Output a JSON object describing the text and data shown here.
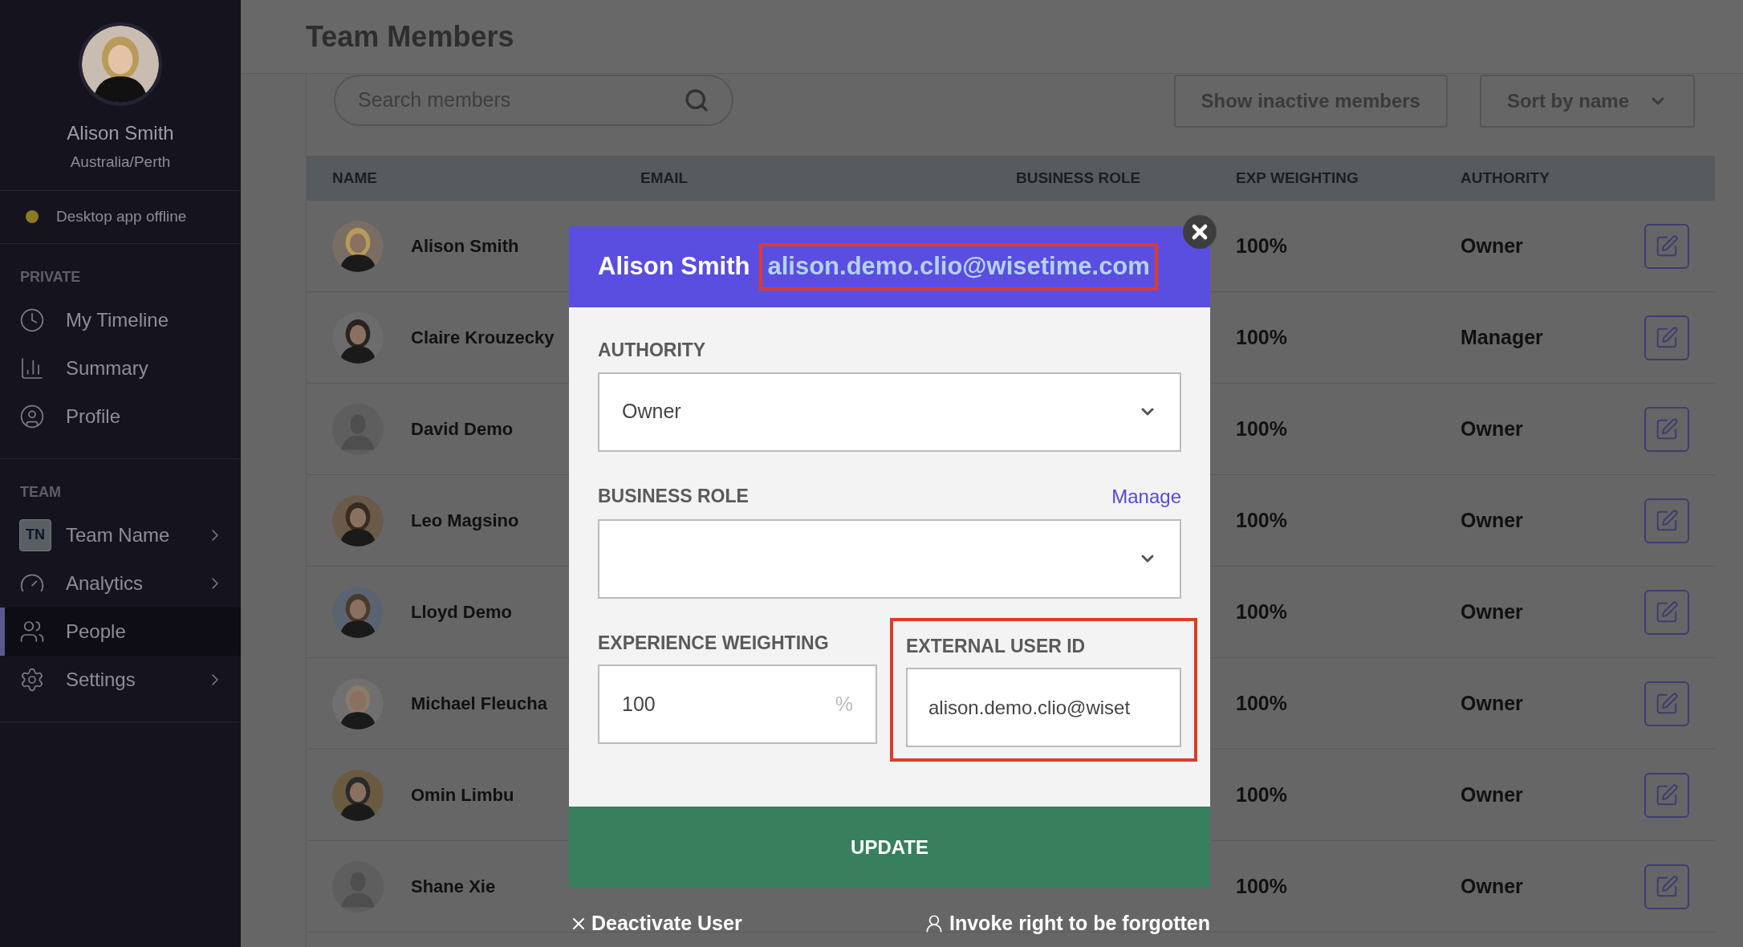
{
  "sidebar": {
    "user": {
      "name": "Alison Smith",
      "location": "Australia/Perth"
    },
    "status": {
      "label": "Desktop app offline",
      "online": false
    },
    "sections": [
      {
        "title": "PRIVATE",
        "items": [
          {
            "label": "My Timeline",
            "selected": false,
            "expandable": false
          },
          {
            "label": "Summary",
            "selected": false,
            "expandable": false
          },
          {
            "label": "Profile",
            "selected": false,
            "expandable": false
          }
        ]
      },
      {
        "title": "TEAM",
        "items": [
          {
            "label": "Team Name",
            "badge": "TN",
            "selected": false,
            "expandable": true
          },
          {
            "label": "Analytics",
            "selected": false,
            "expandable": true
          },
          {
            "label": "People",
            "selected": true,
            "expandable": false
          },
          {
            "label": "Settings",
            "selected": false,
            "expandable": true
          }
        ]
      }
    ]
  },
  "page": {
    "title": "Team Members"
  },
  "toolbar": {
    "search": {
      "placeholder": "Search members"
    },
    "inactive_button": "Show inactive members",
    "sort": "Sort by name"
  },
  "table": {
    "columns": [
      "NAME",
      "EMAIL",
      "BUSINESS ROLE",
      "EXP WEIGHTING",
      "AUTHORITY"
    ],
    "rows": [
      {
        "name": "Alison Smith",
        "exp_weighting": "100%",
        "authority": "Owner"
      },
      {
        "name": "Claire Krouzecky",
        "exp_weighting": "100%",
        "authority": "Manager"
      },
      {
        "name": "David Demo",
        "kind": "placeholder",
        "exp_weighting": "100%",
        "authority": "Owner"
      },
      {
        "name": "Leo Magsino",
        "exp_weighting": "100%",
        "authority": "Owner"
      },
      {
        "name": "Lloyd Demo",
        "exp_weighting": "100%",
        "authority": "Owner"
      },
      {
        "name": "Michael Fleucha",
        "exp_weighting": "100%",
        "authority": "Owner"
      },
      {
        "name": "Omin Limbu",
        "exp_weighting": "100%",
        "authority": "Owner"
      },
      {
        "name": "Shane Xie",
        "kind": "placeholder",
        "exp_weighting": "100%",
        "authority": "Owner"
      }
    ]
  },
  "modal": {
    "name": "Alison Smith",
    "email": "alison.demo.clio@wisetime.com",
    "email_highlighted": true,
    "authority": {
      "label": "AUTHORITY",
      "value": "Owner"
    },
    "business_role": {
      "label": "BUSINESS ROLE",
      "link": "Manage"
    },
    "experience": {
      "label": "EXPERIENCE WEIGHTING",
      "value": "100",
      "suffix": "%"
    },
    "external_id": {
      "label": "EXTERNAL USER ID",
      "value": "alison.demo.clio@wiset",
      "highlighted": true
    },
    "update": "UPDATE",
    "deactivate": "Deactivate User",
    "forget": "Invoke right to be forgotten"
  }
}
